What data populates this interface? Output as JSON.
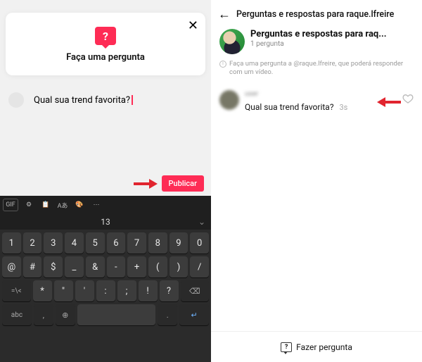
{
  "left": {
    "composer": {
      "close": "✕",
      "icon_glyph": "?",
      "title": "Faça uma pergunta"
    },
    "input": {
      "text": "Qual sua trend favorita?"
    },
    "publish_button": "Publicar",
    "keyboard": {
      "toolbar": [
        "GIF",
        "⚙",
        "📋",
        "Aあ",
        "🎨",
        "⋯"
      ],
      "suggestion": "13",
      "row1": [
        "1",
        "2",
        "3",
        "4",
        "5",
        "6",
        "7",
        "8",
        "9",
        "0"
      ],
      "row2": [
        "@",
        "#",
        "$",
        "_",
        "&",
        "-",
        "+",
        "(",
        ")",
        "/"
      ],
      "row3_left": "=\\<",
      "row3": [
        "*",
        "\"",
        "'",
        ":",
        ";",
        "!",
        "?"
      ],
      "row3_right": "⌫",
      "row4_left": "abc",
      "row4_comma": ",",
      "row4_lang": "⊕",
      "row4_period": ".",
      "row4_enter": "↵"
    }
  },
  "right": {
    "header": {
      "back": "←",
      "title": "Perguntas e respostas para raque.lfreire"
    },
    "info": {
      "title": "Perguntas e respostas para raq...",
      "subtitle": "1 pergunta"
    },
    "hint": "Faça uma pergunta a @raque.lfreire, que poderá responder com um vídeo.",
    "question": {
      "user": "user",
      "text": "Qual sua trend favorita?",
      "time": "3s"
    },
    "footer": {
      "label": "Fazer pergunta"
    }
  }
}
